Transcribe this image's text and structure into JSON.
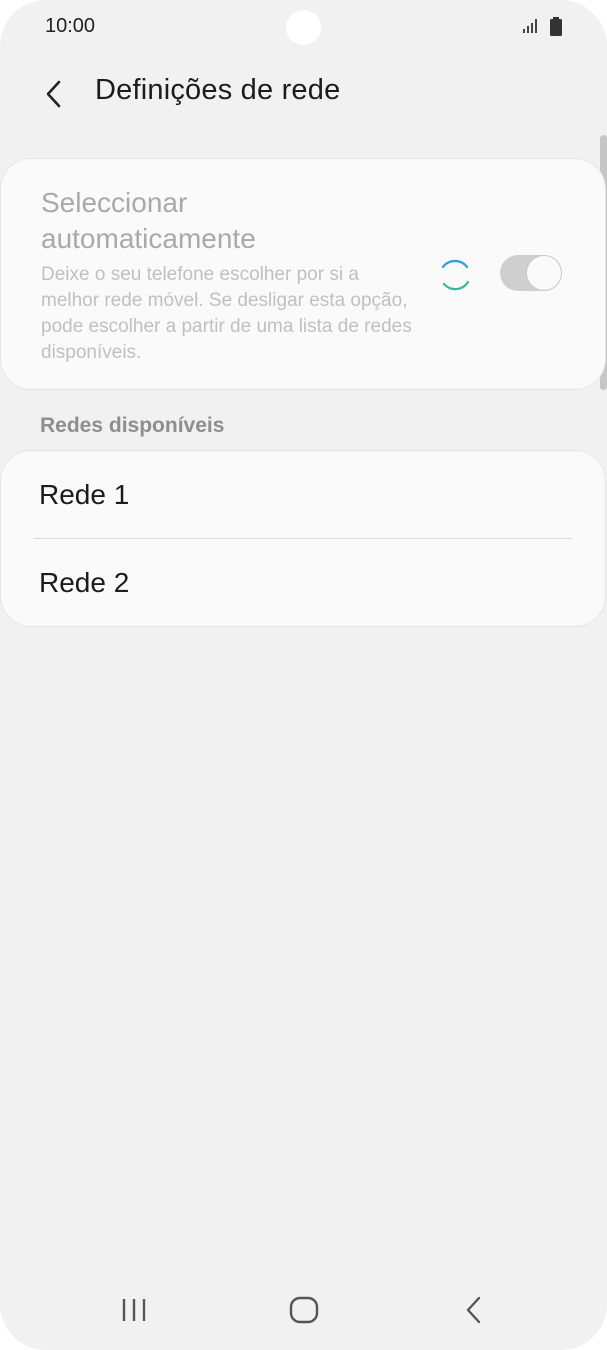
{
  "status_bar": {
    "time": "10:00",
    "icons": [
      "signal-icon",
      "battery-icon"
    ]
  },
  "header": {
    "back_icon": "chevron-left-icon",
    "title": "Definições de rede"
  },
  "auto_select": {
    "title": "Seleccionar automaticamente",
    "description": "Deixe o seu telefone escolher por si a melhor rede móvel. Se desligar esta opção, pode escolher a partir de uma lista de redes disponíveis.",
    "toggle_state": "on",
    "loading": true
  },
  "available_networks": {
    "header": "Redes disponíveis",
    "items": [
      {
        "label": "Rede 1"
      },
      {
        "label": "Rede 2"
      }
    ]
  },
  "nav_bar": {
    "icons": [
      "recent-apps-icon",
      "home-icon",
      "back-icon"
    ]
  },
  "colors": {
    "background": "#f1f1f1",
    "card": "#fafafa",
    "spinner_blue": "#2e9fd8",
    "spinner_green": "#3bb89a"
  }
}
